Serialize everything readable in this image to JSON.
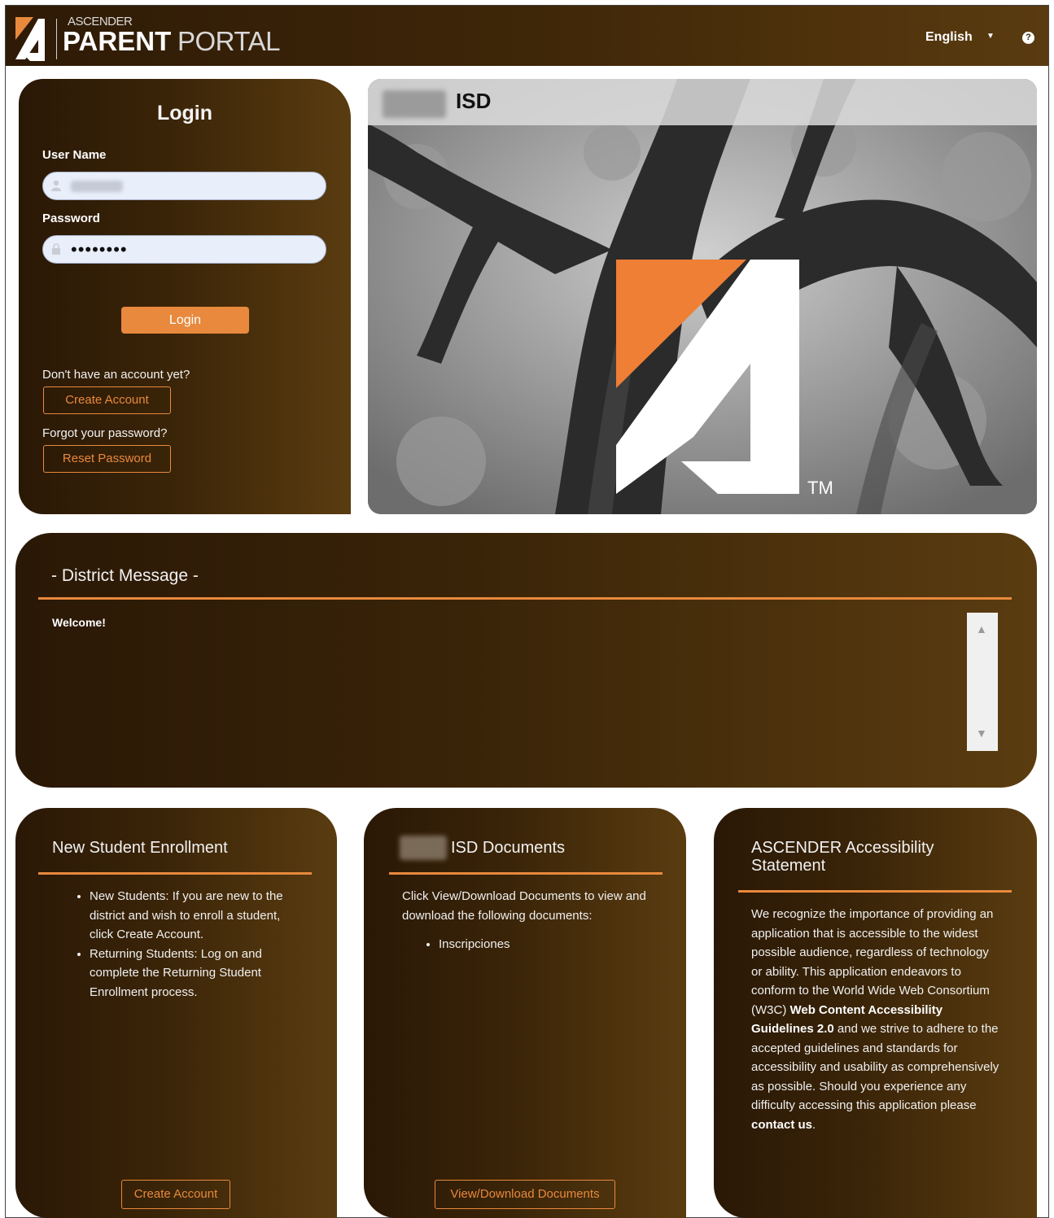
{
  "header": {
    "logo_top": "ASCENDER",
    "logo_parent": "PARENT",
    "logo_portal": "PORTAL",
    "language": "English",
    "help_symbol": "?"
  },
  "login": {
    "title": "Login",
    "username_label": "User Name",
    "password_label": "Password",
    "password_value": "••••••••",
    "login_button": "Login",
    "no_account_text": "Don't have an account yet?",
    "create_account_button": "Create Account",
    "forgot_text": "Forgot your password?",
    "reset_button": "Reset Password"
  },
  "hero": {
    "district_suffix": "ISD",
    "tm": "TM"
  },
  "district_message": {
    "title": "- District Message -",
    "body": "Welcome!"
  },
  "enrollment": {
    "title": "New Student Enrollment",
    "items": [
      "New Students: If you are new to the district and wish to enroll a student, click Create Account.",
      "Returning Students: Log on and complete the Returning Student Enrollment process."
    ],
    "button": "Create Account"
  },
  "documents": {
    "title": "ISD Documents",
    "intro": "Click View/Download Documents to view and download the following documents:",
    "items": [
      "Inscripciones"
    ],
    "button": "View/Download Documents"
  },
  "accessibility": {
    "title": "ASCENDER Accessibility Statement",
    "text_1": "We recognize the importance of providing an application that is accessible to the widest possible audience, regardless of technology or ability. This application endeavors to conform to the World Wide Web Consortium (W3C) ",
    "link_wcag": "Web Content Accessibility Guidelines 2.0",
    "text_2": " and we strive to adhere to the accepted guidelines and standards for accessibility and usability as comprehensively as possible. Should you experience any difficulty accessing this application please ",
    "link_contact": "contact us",
    "text_3": "."
  },
  "colors": {
    "accent": "#e8893d",
    "brown_dark": "#2a1806",
    "brown_light": "#5a3c10"
  }
}
